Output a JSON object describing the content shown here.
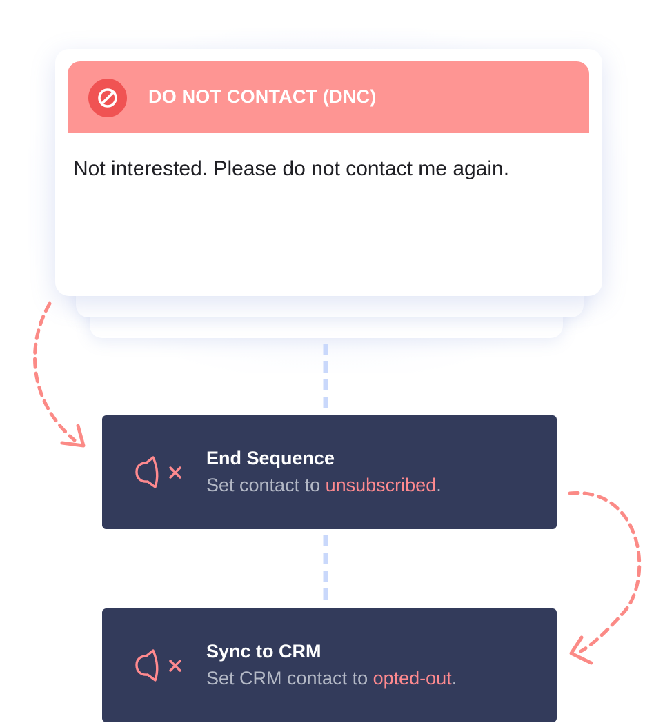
{
  "dnc_card": {
    "icon": "ban-icon",
    "title": "DO NOT CONTACT (DNC)",
    "message": "Not interested. Please do not contact me again."
  },
  "actions": [
    {
      "icon": "bell-off-icon",
      "title": "End Sequence",
      "desc_prefix": "Set contact to ",
      "desc_highlight": "unsubscribed",
      "desc_suffix": "."
    },
    {
      "icon": "bell-off-icon",
      "title": "Sync to CRM",
      "desc_prefix": "Set CRM contact to ",
      "desc_highlight": "opted-out",
      "desc_suffix": "."
    }
  ],
  "colors": {
    "header": "#fe9593",
    "icon_badge": "#f05353",
    "action_bg": "#333b5b",
    "highlight": "#ff8a8f",
    "connector": "#c9d8fb",
    "arrow": "#fb8a86"
  }
}
